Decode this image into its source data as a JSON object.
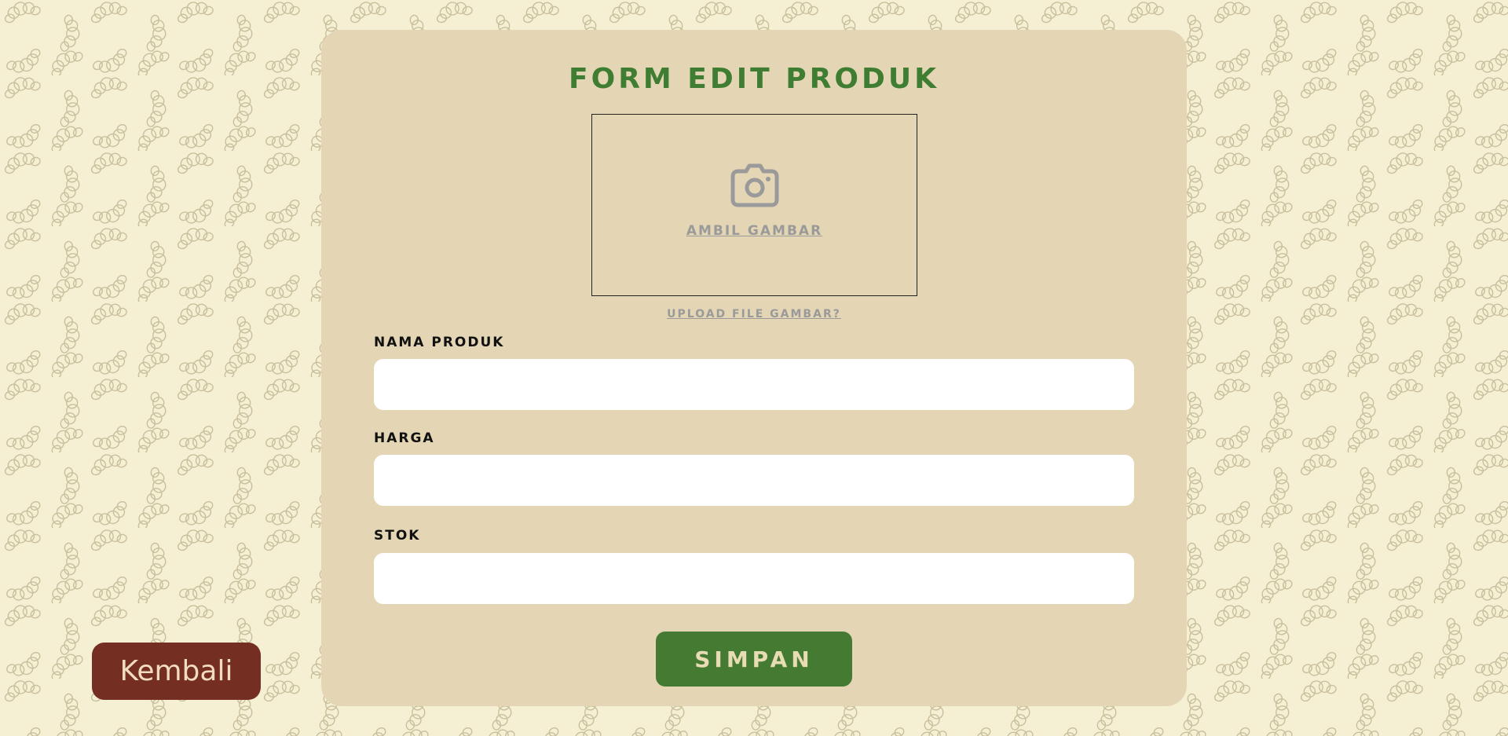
{
  "page": {
    "background_color": "#f5f0d3",
    "pattern_icon": "croissant-icon"
  },
  "form": {
    "title": "FORM EDIT PRODUK",
    "card_color": "#e4d6b5",
    "title_color": "#3f7d32",
    "photo": {
      "icon": "camera-icon",
      "label": "AMBIL GAMBAR"
    },
    "upload_link": "UPLOAD FILE GAMBAR?",
    "fields": [
      {
        "label": "NAMA PRODUK",
        "value": "",
        "placeholder": ""
      },
      {
        "label": "HARGA",
        "value": "",
        "placeholder": ""
      },
      {
        "label": "STOK",
        "value": "",
        "placeholder": ""
      }
    ],
    "save_label": "SIMPAN",
    "save_color": "#457a32"
  },
  "back_button": {
    "label": "Kembali",
    "color": "#742e22"
  }
}
